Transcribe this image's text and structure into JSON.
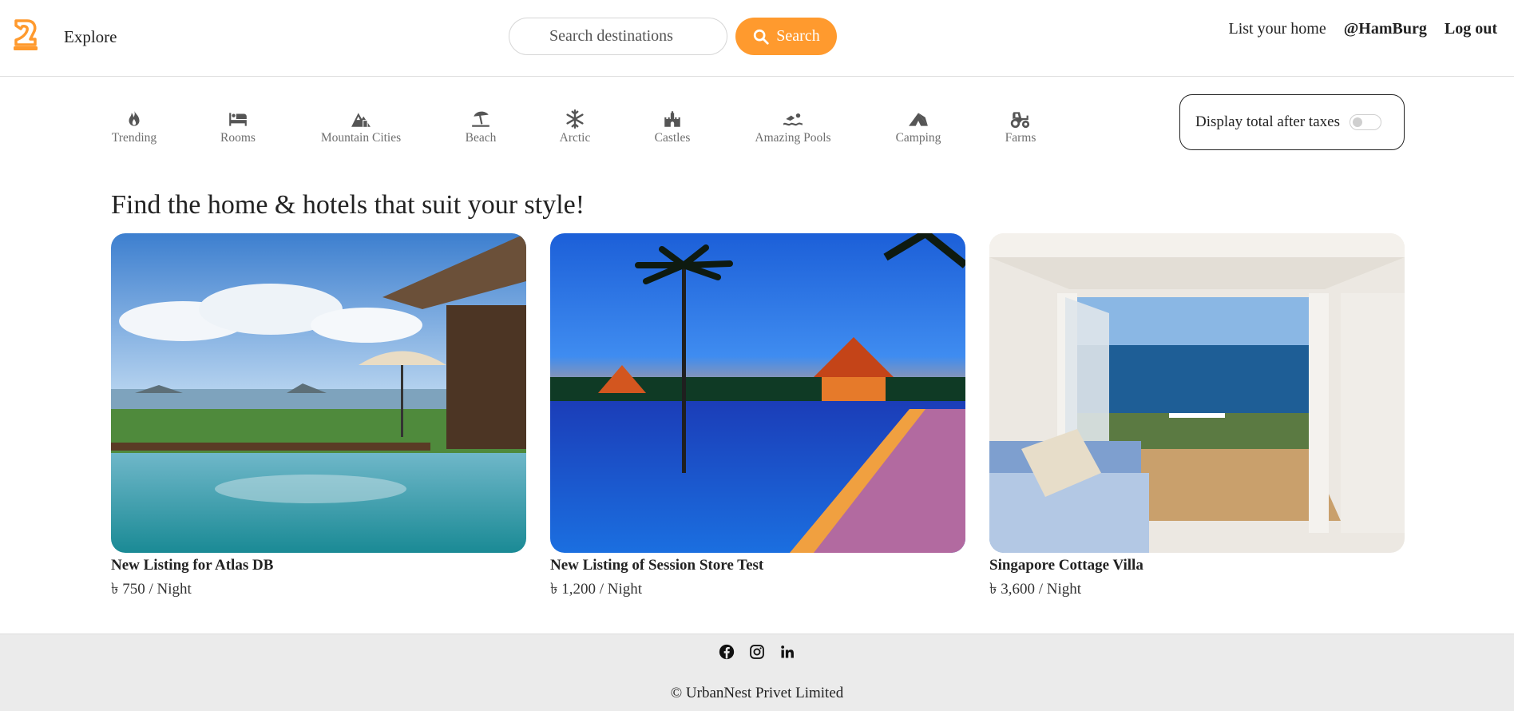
{
  "nav": {
    "explore": "Explore",
    "search_placeholder": "Search destinations",
    "search_label": "Search",
    "list_home": "List your home",
    "username": "@HamBurg",
    "logout": "Log out"
  },
  "colors": {
    "accent": "#ff9a2e",
    "text": "#222222",
    "muted": "#6f6f6f",
    "footer_bg": "#ebebeb"
  },
  "filters": [
    {
      "label": "Trending",
      "icon": "fire-icon"
    },
    {
      "label": "Rooms",
      "icon": "bed-icon"
    },
    {
      "label": "Mountain Cities",
      "icon": "mountain-city-icon"
    },
    {
      "label": "Beach",
      "icon": "umbrella-beach-icon"
    },
    {
      "label": "Arctic",
      "icon": "snowflake-icon"
    },
    {
      "label": "Castles",
      "icon": "castle-icon"
    },
    {
      "label": "Amazing Pools",
      "icon": "swimmer-icon"
    },
    {
      "label": "Camping",
      "icon": "campground-icon"
    },
    {
      "label": "Farms",
      "icon": "tractor-icon"
    }
  ],
  "tax_toggle": {
    "label": "Display total after taxes",
    "enabled": false
  },
  "heading": "Find the home & hotels that suit your style!",
  "listings": [
    {
      "title": "New Listing for Atlas DB",
      "price": "৳ 750 / Night"
    },
    {
      "title": "New Listing of Session Store Test",
      "price": "৳ 1,200 / Night"
    },
    {
      "title": "Singapore Cottage Villa",
      "price": "৳ 3,600 / Night"
    }
  ],
  "footer": {
    "socials": [
      "facebook-icon",
      "instagram-icon",
      "linkedin-icon"
    ],
    "copyright": "© UrbanNest Privet Limited"
  }
}
